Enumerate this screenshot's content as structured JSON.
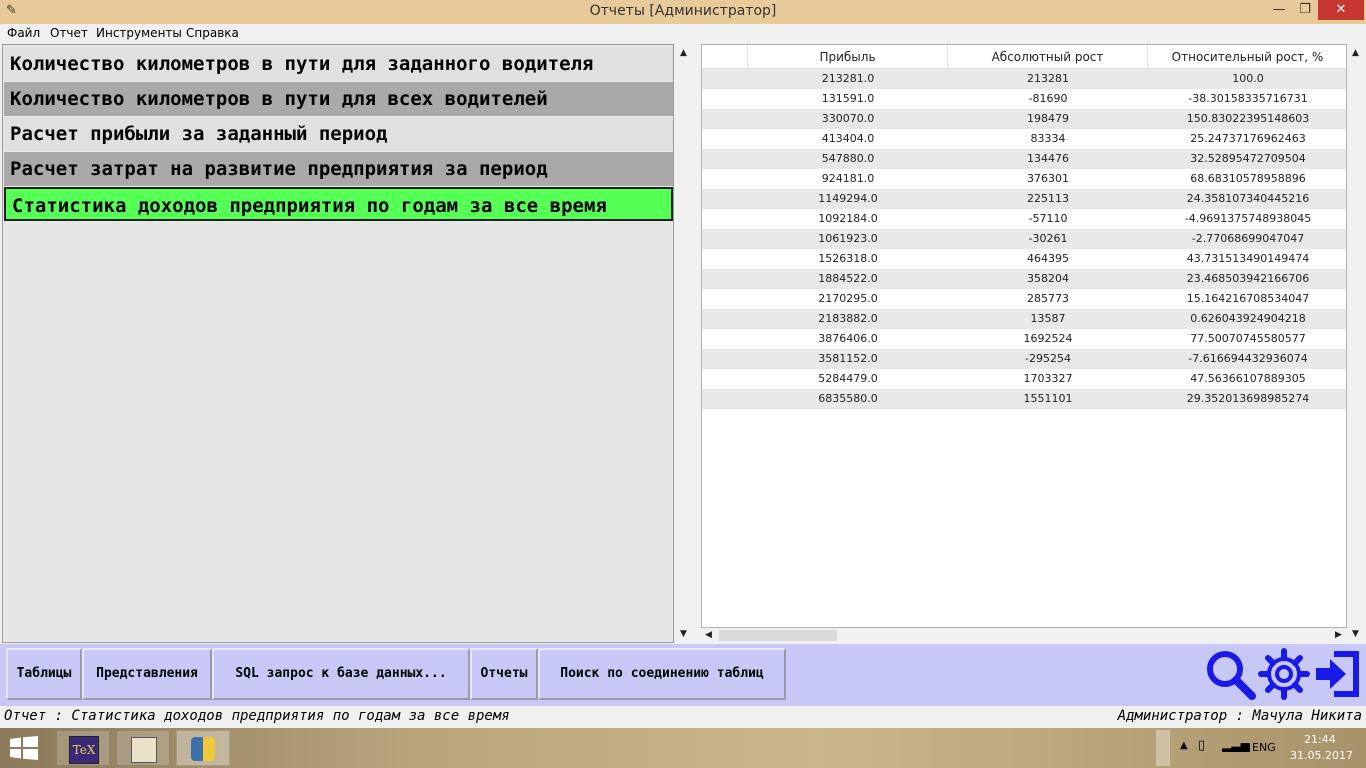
{
  "window": {
    "title": "Отчеты [Администратор]",
    "minimize_glyph": "—",
    "maximize_glyph": "❐",
    "close_glyph": "✕"
  },
  "menu": [
    "Файл",
    "Отчет",
    "Инструменты",
    "Справка"
  ],
  "reports": [
    {
      "label": "Количество километров в пути для заданного водителя",
      "bg": "#e0e0e0"
    },
    {
      "label": "Количество километров в пути для всех водителей",
      "bg": "#a9a9a9"
    },
    {
      "label": "Расчет прибыли за заданный период",
      "bg": "#e0e0e0"
    },
    {
      "label": "Расчет затрат на развитие предприятия за период",
      "bg": "#a9a9a9"
    },
    {
      "label": "Статистика доходов предприятия по годам за все время",
      "bg": "#55ff55"
    }
  ],
  "table": {
    "headers": [
      "Прибыль",
      "Абсолютный рост",
      "Относительный рост, %"
    ],
    "rows": [
      [
        "213281.0",
        "213281",
        "100.0"
      ],
      [
        "131591.0",
        "-81690",
        "-38.30158335716731"
      ],
      [
        "330070.0",
        "198479",
        "150.83022395148603"
      ],
      [
        "413404.0",
        "83334",
        "25.24737176962463"
      ],
      [
        "547880.0",
        "134476",
        "32.52895472709504"
      ],
      [
        "924181.0",
        "376301",
        "68.68310578958896"
      ],
      [
        "1149294.0",
        "225113",
        "24.358107340445216"
      ],
      [
        "1092184.0",
        "-57110",
        "-4.9691375748938045"
      ],
      [
        "1061923.0",
        "-30261",
        "-2.77068699047047"
      ],
      [
        "1526318.0",
        "464395",
        "43.731513490149474"
      ],
      [
        "1884522.0",
        "358204",
        "23.468503942166706"
      ],
      [
        "2170295.0",
        "285773",
        "15.164216708534047"
      ],
      [
        "2183882.0",
        "13587",
        "0.626043924904218"
      ],
      [
        "3876406.0",
        "1692524",
        "77.50070745580577"
      ],
      [
        "3581152.0",
        "-295254",
        "-7.616694432936074"
      ],
      [
        "5284479.0",
        "1703327",
        "47.56366107889305"
      ],
      [
        "6835580.0",
        "1551101",
        "29.352013698985274"
      ]
    ]
  },
  "toolbar": {
    "buttons": [
      "Таблицы",
      "Представления",
      "SQL запрос к базе данных...",
      "Отчеты",
      "Поиск по соединению таблиц"
    ],
    "icons": [
      "search-icon",
      "settings-gear-icon",
      "exit-icon"
    ],
    "accent": "#1a1ae6"
  },
  "status": {
    "left": "Отчет : Статистика доходов предприятия по годам за все время",
    "right": "Администратор : Мачула Никита"
  },
  "taskbar": {
    "lang": "ENG",
    "time": "21:44",
    "date": "31.05.2017",
    "tex_label": "TeX"
  }
}
